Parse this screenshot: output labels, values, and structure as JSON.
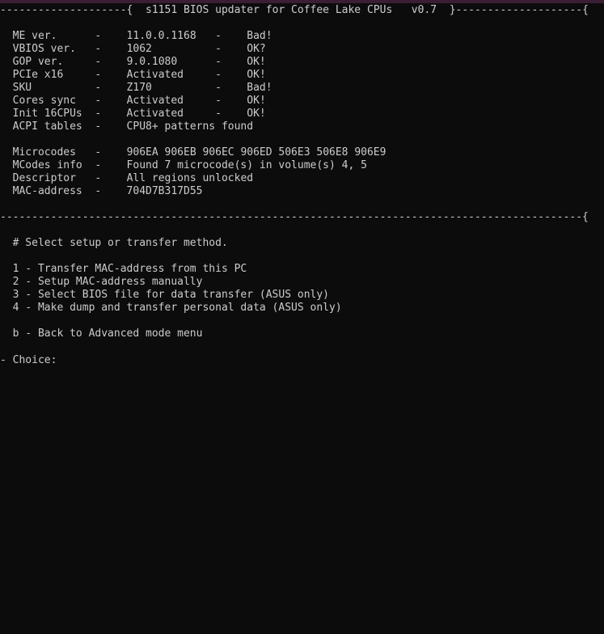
{
  "header": {
    "left_rule": "--------------------{",
    "title": "s1151 BIOS updater for Coffee Lake CPUs",
    "version": "v0.7",
    "right_rule": "}--------------------{"
  },
  "info_rows": [
    {
      "label": "ME ver.",
      "value": "11.0.0.1168",
      "status": "Bad!"
    },
    {
      "label": "VBIOS ver.",
      "value": "1062",
      "status": "OK?"
    },
    {
      "label": "GOP ver.",
      "value": "9.0.1080",
      "status": "OK!"
    },
    {
      "label": "PCIe x16",
      "value": "Activated",
      "status": "OK!"
    },
    {
      "label": "SKU",
      "value": "Z170",
      "status": "Bad!"
    },
    {
      "label": "Cores sync",
      "value": "Activated",
      "status": "OK!"
    },
    {
      "label": "Init 16CPUs",
      "value": "Activated",
      "status": "OK!"
    },
    {
      "label": "ACPI tables",
      "value": "CPU8+ patterns found",
      "status": ""
    }
  ],
  "detail_rows": [
    {
      "label": "Microcodes",
      "value": "906EA 906EB 906EC 906ED 506E3 506E8 906E9"
    },
    {
      "label": "MCodes info",
      "value": "Found 7 microcode(s) in volume(s) 4, 5"
    },
    {
      "label": "Descriptor",
      "value": "All regions unlocked"
    },
    {
      "label": "MAC-address",
      "value": "704D7B317D55"
    }
  ],
  "separator": "--------------------------------------------------------------------------------------------{",
  "menu": {
    "heading": "# Select setup or transfer method.",
    "options": [
      {
        "key": "1",
        "label": "Transfer MAC-address from this PC"
      },
      {
        "key": "2",
        "label": "Setup MAC-address manually"
      },
      {
        "key": "3",
        "label": "Select BIOS file for data transfer (ASUS only)"
      },
      {
        "key": "4",
        "label": "Make dump and transfer personal data (ASUS only)"
      }
    ],
    "back_option": {
      "key": "b",
      "label": "Back to Advanced mode menu"
    }
  },
  "prompt": {
    "left_mark": "-",
    "label": "Choice:"
  }
}
